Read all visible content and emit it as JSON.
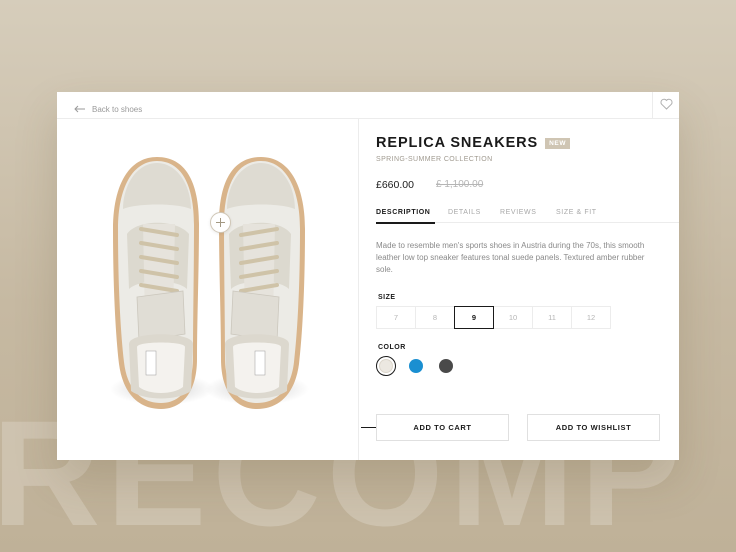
{
  "background_word": "RECOMP",
  "nav": {
    "back_label": "Back to shoes"
  },
  "product": {
    "title": "REPLICA SNEAKERS",
    "badge": "NEW",
    "collection": "SPRING-SUMMER COLLECTION",
    "price": "£660.00",
    "old_price": "£ 1,100.00"
  },
  "tabs": [
    {
      "label": "DESCRIPTION",
      "active": true
    },
    {
      "label": "DETAILS",
      "active": false
    },
    {
      "label": "REVIEWS",
      "active": false
    },
    {
      "label": "SIZE & FIT",
      "active": false
    }
  ],
  "description": "Made to resemble men's sports shoes in Austria during the 70s, this smooth leather low top sneaker features tonal suede panels. Textured amber rubber sole.",
  "size": {
    "label": "SIZE",
    "options": [
      "7",
      "8",
      "9",
      "10",
      "11",
      "12"
    ],
    "selected": "9"
  },
  "color": {
    "label": "COLOR",
    "options": [
      {
        "name": "cream",
        "hex": "#ece8e1",
        "selected": true
      },
      {
        "name": "blue",
        "hex": "#1a8fd1",
        "selected": false
      },
      {
        "name": "dark-gray",
        "hex": "#4a4a4a",
        "selected": false
      }
    ]
  },
  "actions": {
    "add_to_cart": "ADD TO CART",
    "add_to_wishlist": "ADD TO WISHLIST"
  },
  "icons": {
    "back": "arrow-left-icon",
    "favorite": "heart-icon",
    "zoom": "plus-icon"
  }
}
